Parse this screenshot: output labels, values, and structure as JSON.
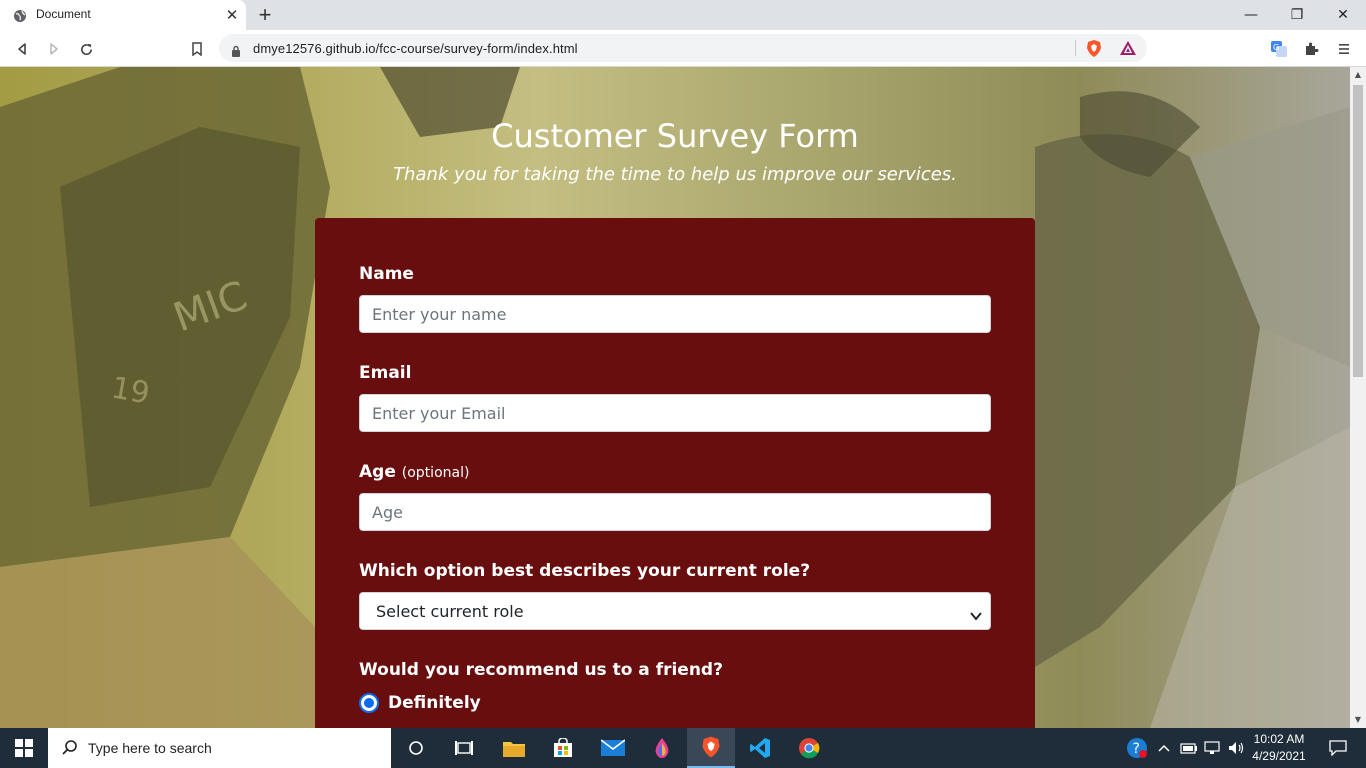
{
  "browser": {
    "tab_title": "Document",
    "url": "dmye12576.github.io/fcc-course/survey-form/index.html",
    "window_controls": {
      "minimize": "—",
      "restore": "❐",
      "close": "✕"
    },
    "new_tab": "+"
  },
  "page": {
    "title": "Customer Survey Form",
    "subtitle": "Thank you for taking the time to help us improve our services.",
    "form": {
      "name": {
        "label": "Name",
        "placeholder": "Enter your name",
        "value": ""
      },
      "email": {
        "label": "Email",
        "placeholder": "Enter your Email",
        "value": ""
      },
      "age": {
        "label": "Age",
        "optional": "(optional)",
        "placeholder": "Age",
        "value": ""
      },
      "role": {
        "label": "Which option best describes your current role?",
        "selected": "Select current role"
      },
      "recommend": {
        "label": "Would you recommend us to a friend?",
        "options": [
          {
            "label": "Definitely",
            "checked": true
          }
        ]
      }
    }
  },
  "taskbar": {
    "search_placeholder": "Type here to search",
    "time": "10:02 AM",
    "date": "4/29/2021",
    "apps": [
      "task-view-icon",
      "file-explorer-icon",
      "store-icon",
      "mail-icon",
      "paint-icon",
      "brave-icon",
      "vscode-icon",
      "chrome-icon"
    ]
  },
  "colors": {
    "form_background": "#690e0e",
    "radio_accent": "#0b6cf0",
    "taskbar": "#1f2c3a",
    "brave": "#fb542b"
  }
}
